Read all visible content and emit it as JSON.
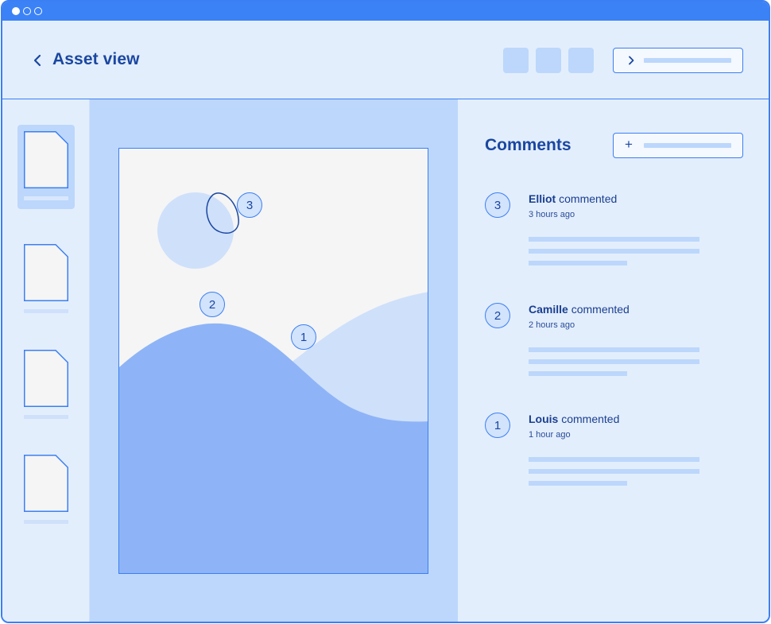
{
  "app": {
    "title": "Asset view"
  },
  "colors": {
    "accent": "#3b7ff3",
    "placeholder": "#bcd7fb",
    "panel": "#e3eefd",
    "dark_text": "#1a47a0"
  },
  "header": {
    "back_icon": "chevron-left-icon",
    "tool_buttons": [
      "tool-button-1",
      "tool-button-2",
      "tool-button-3"
    ],
    "next_icon": "chevron-right-icon"
  },
  "canvas": {
    "pins": [
      {
        "number": "1"
      },
      {
        "number": "2"
      },
      {
        "number": "3"
      }
    ]
  },
  "comments": {
    "title": "Comments",
    "add_icon": "plus-icon",
    "add_label": "+",
    "items": [
      {
        "pin": "3",
        "author": "Elliot",
        "action": " commented",
        "time": "3 hours ago"
      },
      {
        "pin": "2",
        "author": "Camille",
        "action": " commented",
        "time": "2 hours ago"
      },
      {
        "pin": "1",
        "author": "Louis",
        "action": " commented",
        "time": "1 hour ago"
      }
    ]
  }
}
